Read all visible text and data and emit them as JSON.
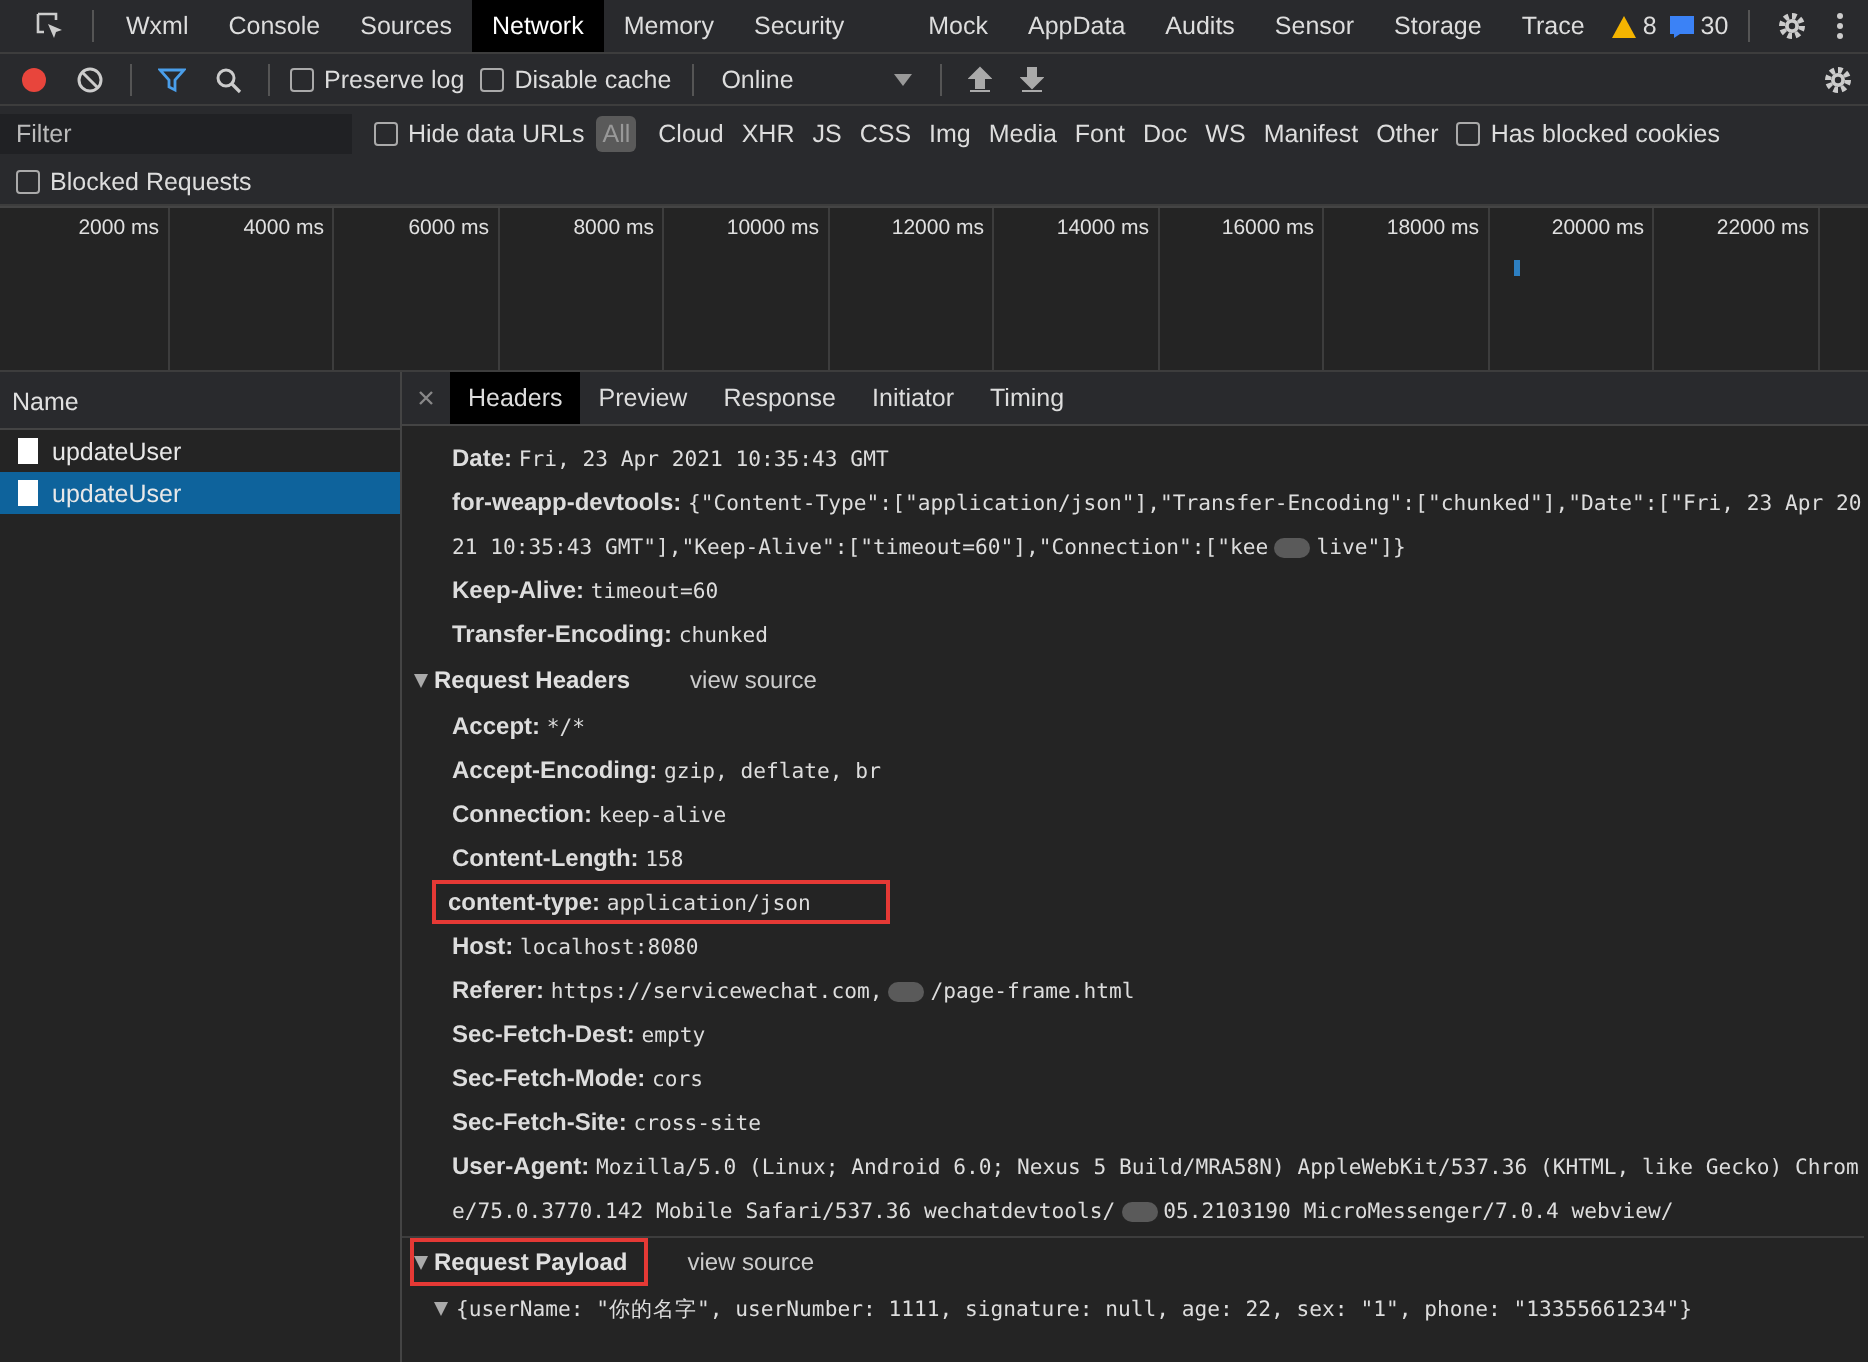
{
  "main_tabs": [
    {
      "label": "Wxml",
      "selected": false
    },
    {
      "label": "Console",
      "selected": false
    },
    {
      "label": "Sources",
      "selected": false
    },
    {
      "label": "Network",
      "selected": true
    },
    {
      "label": "Memory",
      "selected": false
    },
    {
      "label": "Security",
      "selected": false
    },
    {
      "label": "Mock",
      "selected": false
    },
    {
      "label": "AppData",
      "selected": false
    },
    {
      "label": "Audits",
      "selected": false
    },
    {
      "label": "Sensor",
      "selected": false
    },
    {
      "label": "Storage",
      "selected": false
    },
    {
      "label": "Trace",
      "selected": false
    }
  ],
  "warnings": "8",
  "messages": "30",
  "toolbar": {
    "preserve_log": {
      "label": "Preserve log",
      "checked": false
    },
    "disable_cache": {
      "label": "Disable cache",
      "checked": false
    },
    "throttling": "Online"
  },
  "filter": {
    "placeholder": "Filter",
    "hide_data_urls": {
      "label": "Hide data URLs",
      "checked": false
    },
    "types": [
      {
        "label": "All",
        "selected": true
      },
      {
        "label": "Cloud",
        "selected": false
      },
      {
        "label": "XHR",
        "selected": false
      },
      {
        "label": "JS",
        "selected": false
      },
      {
        "label": "CSS",
        "selected": false
      },
      {
        "label": "Img",
        "selected": false
      },
      {
        "label": "Media",
        "selected": false
      },
      {
        "label": "Font",
        "selected": false
      },
      {
        "label": "Doc",
        "selected": false
      },
      {
        "label": "WS",
        "selected": false
      },
      {
        "label": "Manifest",
        "selected": false
      },
      {
        "label": "Other",
        "selected": false
      }
    ],
    "has_blocked_cookies": {
      "label": "Has blocked cookies",
      "checked": false
    },
    "blocked_requests": {
      "label": "Blocked Requests",
      "checked": false
    }
  },
  "timeline": {
    "ticks": [
      "2000 ms",
      "4000 ms",
      "6000 ms",
      "8000 ms",
      "10000 ms",
      "12000 ms",
      "14000 ms",
      "16000 ms",
      "18000 ms",
      "20000 ms",
      "22000 ms"
    ]
  },
  "requests": {
    "column": "Name",
    "items": [
      {
        "name": "updateUser",
        "selected": false
      },
      {
        "name": "updateUser",
        "selected": true
      }
    ]
  },
  "detail_tabs": [
    {
      "label": "Headers",
      "selected": true
    },
    {
      "label": "Preview",
      "selected": false
    },
    {
      "label": "Response",
      "selected": false
    },
    {
      "label": "Initiator",
      "selected": false
    },
    {
      "label": "Timing",
      "selected": false
    }
  ],
  "response_headers": [
    {
      "name": "Date:",
      "value": "Fri, 23 Apr 2021 10:35:43 GMT"
    },
    {
      "name": "for-weapp-devtools:",
      "value": "{\"Content-Type\":[\"application/json\"],\"Transfer-Encoding\":[\"chunked\"],\"Date\":[\"Fri, 23 Apr 2021 10:35:43 GMT\"],\"Keep-Alive\":[\"timeout=60\"],\"Connection\":[\"kee",
      "value_tail": "live\"]}"
    },
    {
      "name": "Keep-Alive:",
      "value": "timeout=60"
    },
    {
      "name": "Transfer-Encoding:",
      "value": "chunked"
    }
  ],
  "request_headers": {
    "title": "Request Headers",
    "expanded": true,
    "link": "view source",
    "highlighted": false,
    "rows": [
      {
        "name": "Accept:",
        "value": "*/*",
        "highlighted": false
      },
      {
        "name": "Accept-Encoding:",
        "value": "gzip, deflate, br",
        "highlighted": false
      },
      {
        "name": "Connection:",
        "value": "keep-alive",
        "highlighted": false
      },
      {
        "name": "Content-Length:",
        "value": "158",
        "highlighted": false
      },
      {
        "name": "content-type:",
        "value": "application/json",
        "highlighted": true
      },
      {
        "name": "Host:",
        "value": "localhost:8080",
        "highlighted": false
      },
      {
        "name": "Referer:",
        "value": "https://servicewechat.com,",
        "value_tail": "/page-frame.html",
        "highlighted": false
      },
      {
        "name": "Sec-Fetch-Dest:",
        "value": "empty",
        "highlighted": false
      },
      {
        "name": "Sec-Fetch-Mode:",
        "value": "cors",
        "highlighted": false
      },
      {
        "name": "Sec-Fetch-Site:",
        "value": "cross-site",
        "highlighted": false
      },
      {
        "name": "User-Agent:",
        "value": "Mozilla/5.0 (Linux; Android 6.0; Nexus 5 Build/MRA58N) AppleWebKit/537.36 (KHTML, like Gecko) Chrome/75.0.3770.142 Mobile Safari/537.36 wechatdevtools/",
        "value_tail": "05.2103190 MicroMessenger/7.0.4 webview/",
        "highlighted": false
      }
    ]
  },
  "payload": {
    "title": "Request Payload",
    "expanded": true,
    "link": "view source",
    "highlighted": true,
    "line": "{userName: \"你的名字\", userNumber: 1111, signature: null, age: 22, sex: \"1\", phone: \"13355661234\"}"
  }
}
